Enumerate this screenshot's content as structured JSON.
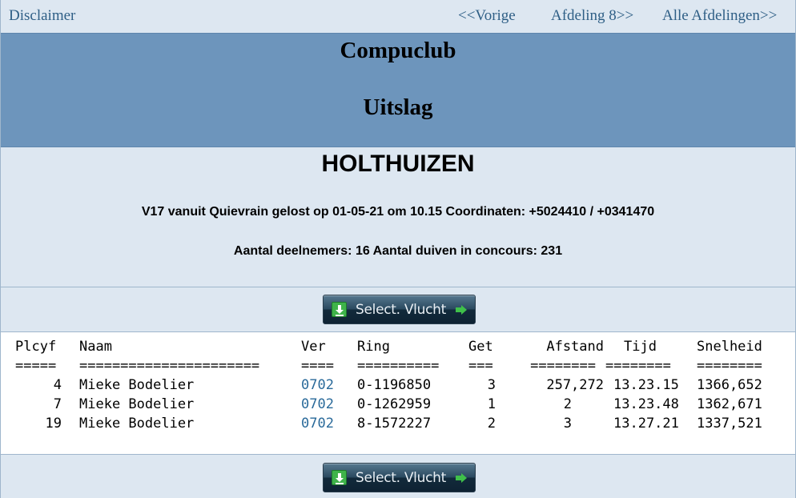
{
  "nav": {
    "disclaimer": "Disclaimer",
    "prev": "<<Vorige",
    "next": "Afdeling 8>>",
    "all": "Alle Afdelingen>>"
  },
  "banner": {
    "club": "Compuclub",
    "title": "Uitslag"
  },
  "info": {
    "place": "HOLTHUIZEN",
    "flight": "V17 vanuit Quievrain gelost op 01-05-21 om 10.15 Coordinaten: +5024410 / +0341470",
    "count": "Aantal deelnemers: 16 Aantal duiven in concours: 231"
  },
  "button": {
    "label": "Select. Vlucht"
  },
  "results": {
    "headers": [
      "Plcyf",
      "Naam",
      "Ver",
      "Ring",
      "Get",
      "Afstand",
      "Tijd",
      "Snelheid"
    ],
    "separators": [
      "=====",
      "======================",
      "====",
      "==========",
      "===",
      "========",
      "========",
      "========"
    ],
    "rows": [
      [
        "4",
        "Mieke Bodelier",
        "0702",
        "0-1196850",
        "3",
        "257,272",
        "13.23.15",
        "1366,652"
      ],
      [
        "7",
        "Mieke Bodelier",
        "0702",
        "0-1262959",
        "1",
        "2",
        "13.23.48",
        "1362,671"
      ],
      [
        "19",
        "Mieke Bodelier",
        "0702",
        "8-1572227",
        "2",
        "3",
        "13.27.21",
        "1337,521"
      ]
    ]
  },
  "colors": {
    "banner": "#6d95bc",
    "background": "#dde7f1",
    "link": "#2f5f86"
  }
}
